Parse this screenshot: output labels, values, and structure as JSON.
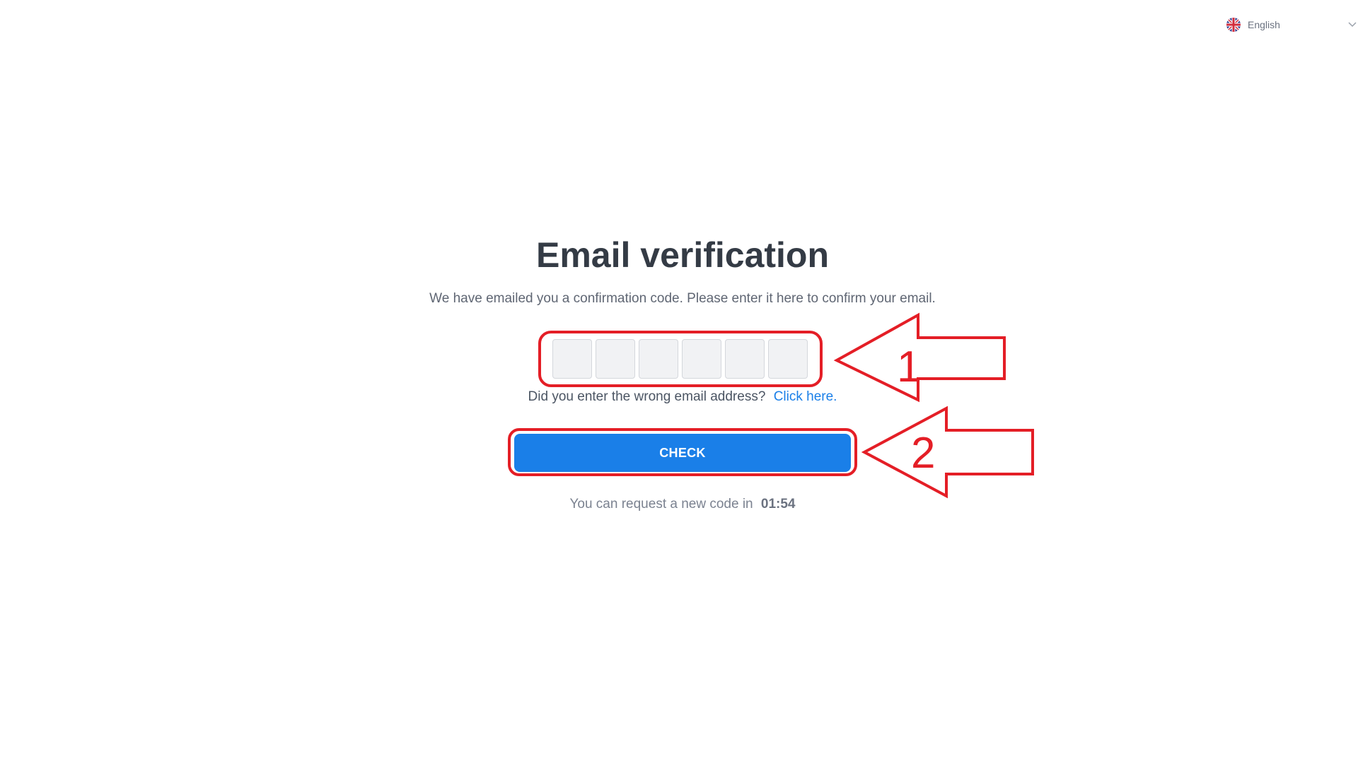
{
  "language_selector": {
    "label": "English",
    "flag_icon": "uk-flag-icon",
    "chevron_icon": "chevron-down-icon"
  },
  "main": {
    "title": "Email verification",
    "subtitle": "We have emailed you a confirmation code. Please enter it here to confirm your email.",
    "code_inputs": [
      "",
      "",
      "",
      "",
      "",
      ""
    ],
    "wrong_email_text": "Did you enter the wrong email address?",
    "click_here_link": "Click here.",
    "check_button_label": "CHECK",
    "resend_text": "You can request a new code in",
    "resend_timer": "01:54"
  },
  "annotations": {
    "arrow_1_label": "1",
    "arrow_2_label": "2"
  },
  "colors": {
    "accent": "#1a7fe8",
    "annotation_red": "#e41e26",
    "title": "#343b45"
  }
}
